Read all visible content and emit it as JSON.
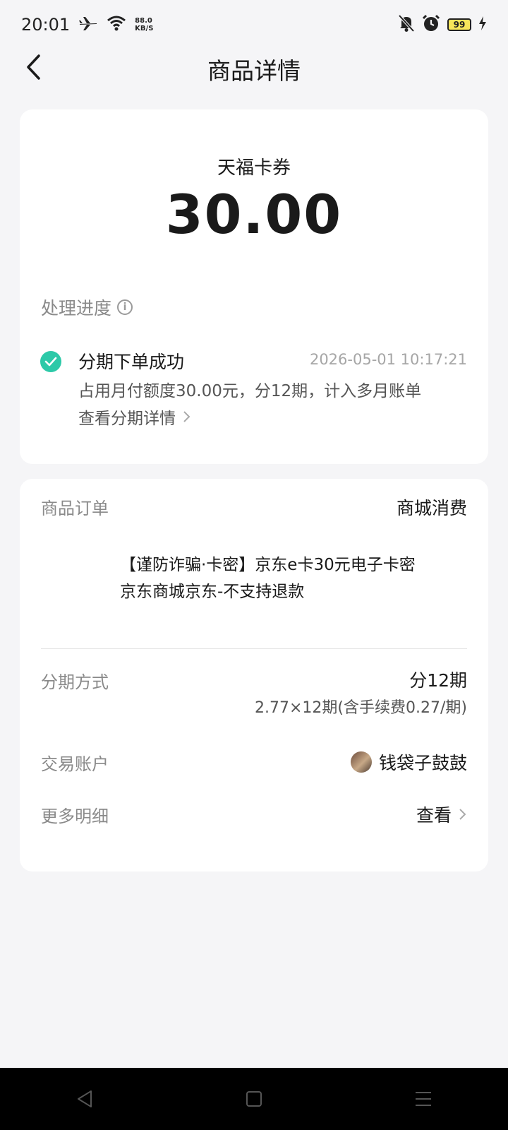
{
  "status_bar": {
    "time": "20:01",
    "speed_value": "88.0",
    "speed_unit": "KB/S",
    "battery": "99"
  },
  "nav": {
    "title": "商品详情"
  },
  "summary": {
    "merchant": "天福卡券",
    "amount": "30.00"
  },
  "progress": {
    "title": "处理进度",
    "step_title": "分期下单成功",
    "step_time": "2026-05-01 10:17:21",
    "step_desc": "占用月付额度30.00元，分12期，计入多月账单",
    "step_link": "查看分期详情"
  },
  "order": {
    "label": "商品订单",
    "value": "商城消费",
    "product_line1": "【谨防诈骗·卡密】京东e卡30元电子卡密",
    "product_line2": "京东商城京东-不支持退款",
    "installment_label": "分期方式",
    "installment_value": "分12期",
    "installment_detail": "2.77×12期(含手续费0.27/期)",
    "account_label": "交易账户",
    "account_value": "钱袋子鼓鼓",
    "more_label": "更多明细",
    "more_value": "查看"
  },
  "colors": {
    "accent": "#2cc9a8",
    "background": "#f5f5f7"
  }
}
